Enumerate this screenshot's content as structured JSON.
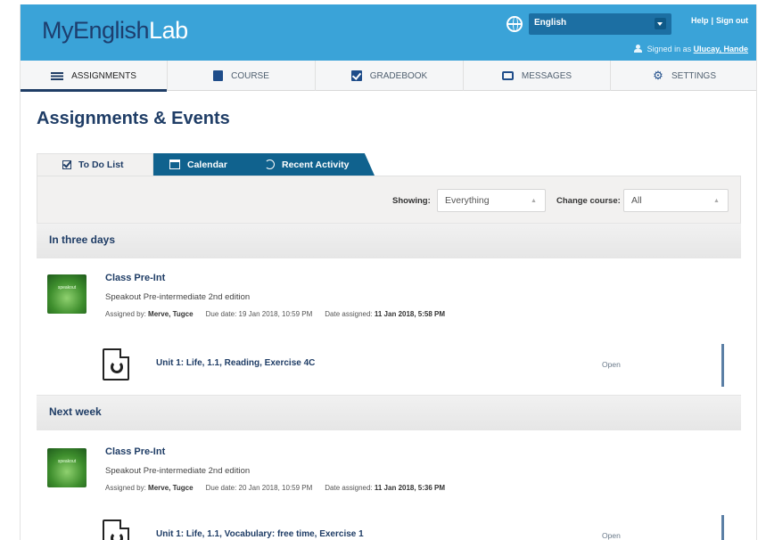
{
  "header": {
    "logo": {
      "my": "MyEnglish",
      "lab": "Lab"
    },
    "language": "English",
    "help": "Help",
    "separator": "|",
    "sign_out": "Sign out",
    "signed_in_prefix": "Signed in as",
    "signed_in_user": "Ulucay, Hande"
  },
  "nav": {
    "tabs": [
      {
        "label": "ASSIGNMENTS",
        "icon": "list-icon",
        "active": true
      },
      {
        "label": "COURSE",
        "icon": "book-icon",
        "active": false
      },
      {
        "label": "GRADEBOOK",
        "icon": "check-icon",
        "active": false
      },
      {
        "label": "MESSAGES",
        "icon": "message-icon",
        "active": false
      },
      {
        "label": "SETTINGS",
        "icon": "gear-icon",
        "active": false
      }
    ]
  },
  "page": {
    "title": "Assignments & Events"
  },
  "subtabs": {
    "todo": "To Do List",
    "calendar": "Calendar",
    "recent": "Recent Activity"
  },
  "filters": {
    "showing_label": "Showing:",
    "showing_value": "Everything",
    "course_label": "Change course:",
    "course_value": "All"
  },
  "sections": [
    {
      "heading": "In three days",
      "item": {
        "course": "Class Pre-Int",
        "book": "Speakout Pre-intermediate 2nd edition",
        "thumb_text": "speakout",
        "assigned_by_label": "Assigned by:",
        "assigned_by": "Merve, Tugce",
        "due_label": "Due date:",
        "due": "19 Jan 2018, 10:59 PM",
        "date_assigned_label": "Date assigned:",
        "date_assigned": "11 Jan 2018, 5:58 PM",
        "exercise": "Unit 1: Life, 1.1, Reading, Exercise 4C",
        "open": "Open"
      }
    },
    {
      "heading": "Next week",
      "item": {
        "course": "Class Pre-Int",
        "book": "Speakout Pre-intermediate 2nd edition",
        "thumb_text": "speakout",
        "assigned_by_label": "Assigned by:",
        "assigned_by": "Merve, Tugce",
        "due_label": "Due date:",
        "due": "20 Jan 2018, 10:59 PM",
        "date_assigned_label": "Date assigned:",
        "date_assigned": "11 Jan 2018, 5:36 PM",
        "exercise": "Unit 1: Life, 1.1, Vocabulary: free time, Exercise 1",
        "open": "Open"
      }
    }
  ],
  "colors": {
    "header": "#3aa3d8",
    "navy": "#1f3d66",
    "tab_dark": "#10628e"
  }
}
